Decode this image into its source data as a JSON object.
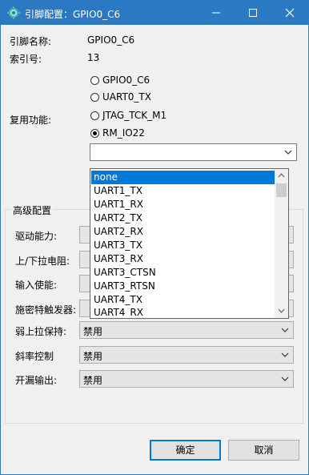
{
  "window": {
    "title": "引脚配置：GPIO0_C6"
  },
  "pin": {
    "name_label": "引脚名称:",
    "name_value": "GPIO0_C6",
    "index_label": "索引号:",
    "index_value": "13",
    "mux_label": "复用功能:"
  },
  "mux_options": [
    {
      "label": "GPIO0_C6",
      "checked": false
    },
    {
      "label": "UART0_TX",
      "checked": false
    },
    {
      "label": "JTAG_TCK_M1",
      "checked": false
    },
    {
      "label": "RM_IO22",
      "checked": true
    }
  ],
  "rm_select": {
    "value": ""
  },
  "dropdown": {
    "items": [
      "none",
      "UART1_TX",
      "UART1_RX",
      "UART2_TX",
      "UART2_RX",
      "UART3_TX",
      "UART3_RX",
      "UART3_CTSN",
      "UART3_RTSN",
      "UART4_TX",
      "UART4_RX"
    ],
    "selected_index": 0
  },
  "advanced": {
    "title": "高级配置",
    "rows": [
      {
        "label": "驱动能力:",
        "value": ""
      },
      {
        "label": "上/下拉电阻:",
        "value": ""
      },
      {
        "label": "输入使能:",
        "value": ""
      },
      {
        "label": "施密特触发器:",
        "value": ""
      },
      {
        "label": "弱上拉保持:",
        "value": "禁用"
      },
      {
        "label": "斜率控制",
        "value": "禁用"
      },
      {
        "label": "开漏输出:",
        "value": "禁用"
      }
    ]
  },
  "buttons": {
    "ok": "确定",
    "cancel": "取消"
  },
  "colors": {
    "titlebar": "#2b79c2",
    "selection": "#0078d7"
  }
}
